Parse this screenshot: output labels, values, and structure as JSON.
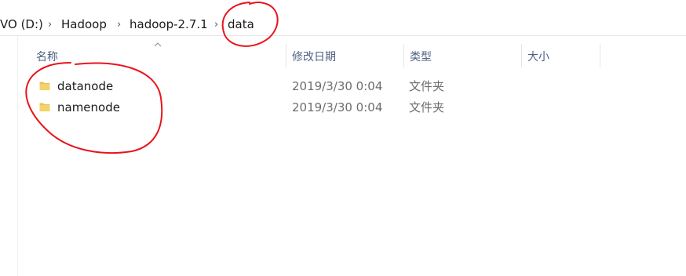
{
  "breadcrumb": {
    "items": [
      "VO (D:)",
      "Hadoop",
      "hadoop-2.7.1",
      "data"
    ],
    "separator": "›"
  },
  "columns": {
    "name": "名称",
    "modified": "修改日期",
    "type": "类型",
    "size": "大小"
  },
  "files": [
    {
      "name": "datanode",
      "modified": "2019/3/30 0:04",
      "type": "文件夹",
      "size": ""
    },
    {
      "name": "namenode",
      "modified": "2019/3/30 0:04",
      "type": "文件夹",
      "size": ""
    }
  ],
  "colors": {
    "folder": "#e8c05a",
    "header_text": "#4d6082",
    "annotation": "#e8141c"
  }
}
